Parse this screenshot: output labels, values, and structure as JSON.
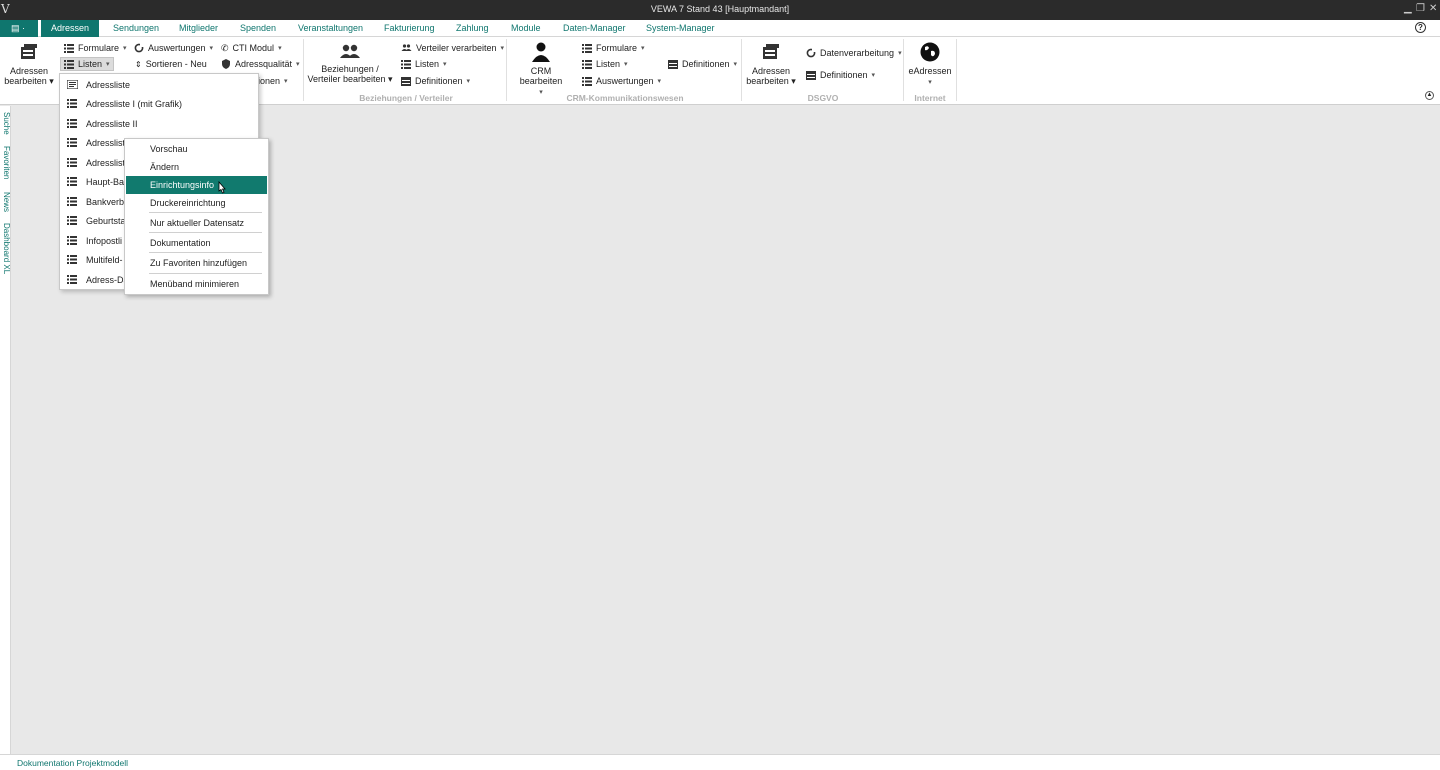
{
  "window": {
    "title": "VEWA 7 Stand 43 [Hauptmandant]",
    "logo": "V",
    "minimize": "▁",
    "restore": "❐",
    "close": "✕"
  },
  "tabs": {
    "app_menu": "▤ ·",
    "items": [
      "Adressen",
      "Sendungen",
      "Mitglieder",
      "Spenden",
      "Veranstaltungen",
      "Fakturierung",
      "Zahlung",
      "Module",
      "Daten-Manager",
      "System-Manager"
    ],
    "active": "Adressen",
    "help": "?"
  },
  "ribbon": {
    "adressen_bearbeiten": [
      "Adressen",
      "bearbeiten ▾"
    ],
    "formulare": "Formulare",
    "listen": "Listen",
    "auswertungen": "Auswertungen",
    "sortieren": "Sortieren - Neu",
    "cti_modul": "CTI Modul",
    "adressqualitaet": "Adressqualität",
    "optionen_partial": "ionen",
    "beziehungen": [
      "Beziehungen /",
      "Verteiler bearbeiten ▾"
    ],
    "verteiler_verarbeiten": "Verteiler verarbeiten",
    "listen2": "Listen",
    "definitionen": "Definitionen",
    "group_beziehungen": "Beziehungen / Verteiler",
    "crm_bearbeiten": "CRM bearbeiten",
    "crm_formulare": "Formulare",
    "crm_listen": "Listen",
    "crm_auswertungen": "Auswertungen",
    "crm_definitionen": "Definitionen",
    "group_crm": "CRM-Kommunikationswesen",
    "dsgvo_adressen": [
      "Adressen",
      "bearbeiten ▾"
    ],
    "datenverarbeitung": "Datenverarbeitung",
    "dsgvo_definitionen": "Definitionen",
    "group_dsgvo": "DSGVO",
    "eadressen": "eAdressen",
    "group_internet": "Internet"
  },
  "sidebar": {
    "tabs": [
      "Suche",
      "Favoriten",
      "News",
      "Dashboard XL"
    ]
  },
  "listen_menu": {
    "items": [
      "Adressliste",
      "Adressliste I (mit Grafik)",
      "Adressliste II",
      "Adresslist",
      "Adresslist",
      "Haupt-Ba",
      "Bankverbi",
      "Geburtsta",
      "Infopostli",
      "Multifeld-",
      "Adress-Da"
    ]
  },
  "context_menu": {
    "items": [
      "Vorschau",
      "Ändern",
      "Einrichtungsinfo",
      "Druckereinrichtung",
      "Nur aktueller Datensatz",
      "Dokumentation",
      "Zu Favoriten hinzufügen",
      "Menüband minimieren"
    ],
    "highlighted": "Einrichtungsinfo"
  },
  "statusbar": {
    "text": "Dokumentation Projektmodell"
  },
  "colors": {
    "accent": "#0f766e",
    "titlebar": "#2b2b2b",
    "workspace": "#e8e8e8"
  },
  "icons": [
    "list-icon",
    "refresh-icon",
    "phone-icon",
    "shield-icon",
    "sort-icon",
    "people-icon",
    "person-icon",
    "database-icon",
    "globe-icon",
    "printer-icon",
    "cursor-icon"
  ]
}
